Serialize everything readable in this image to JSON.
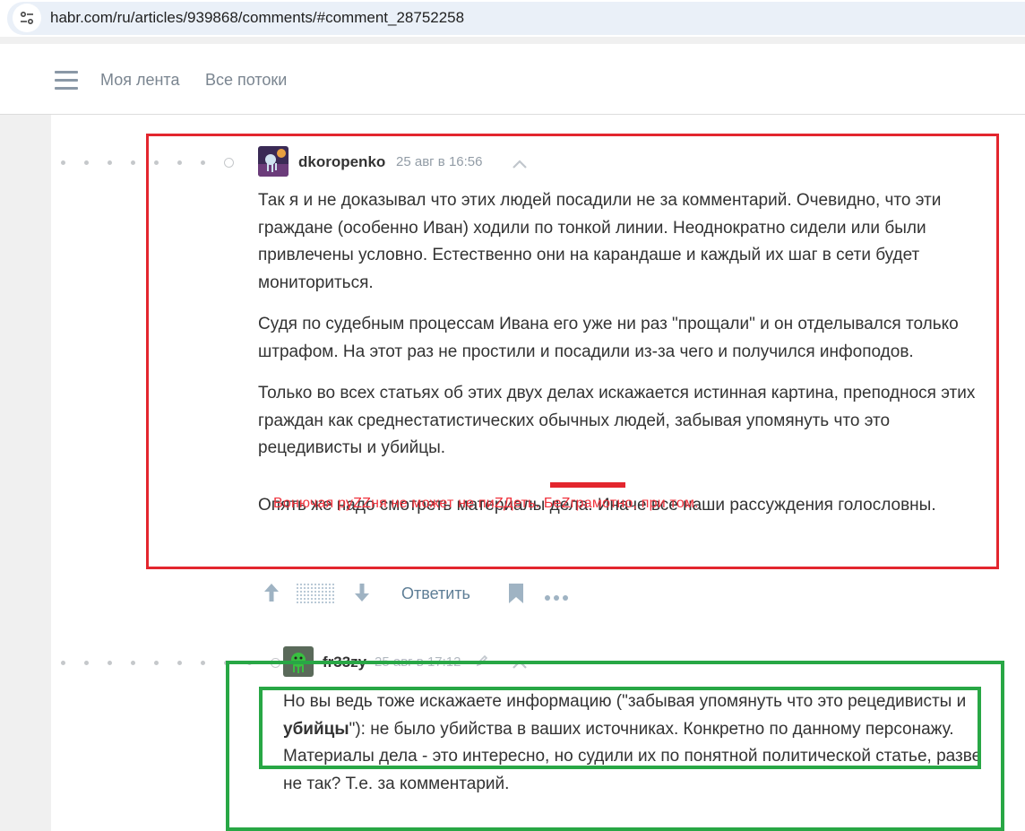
{
  "browser": {
    "url": "habr.com/ru/articles/939868/comments/#comment_28752258",
    "site_info_icon": "tune-icon"
  },
  "header": {
    "menu_icon": "hamburger-menu-icon",
    "nav": [
      "Моя лента",
      "Все потоки"
    ]
  },
  "comment1": {
    "author": "dkoropenko",
    "time": "25 авг в 16:56",
    "paragraphs": [
      "Так я и не доказывал что этих людей посадили не за комментарий. Очевидно, что эти граждане (особенно Иван) ходили по тонкой линии. Неоднократно сидели или были привлечены условно. Естественно они на карандаше и каждый их шаг в сети будет мониториться.",
      "Судя по судебным процессам Ивана его уже ни раз \"прощали\" и он отделывался только штрафом. На этот раз не простили и посадили из-за чего и получился инфоподов.",
      "Только во всех статьях об этих двух делах искажается истинная картина, преподнося этих граждан как среднестатистических обычных людей, забывая упомянуть что это рецедивисты и убийцы.",
      "Опять же надо смотреть материалы дела. Иначе все наши рассуждения голословны."
    ],
    "p3_main": "Только во всех статьях об этих двух делах искажается истинная картина, преподнося этих граждан как среднестатистических обычных людей, забывая упомянуть что это рецедивисты и ",
    "p3_tail": "убийцы."
  },
  "annotation": "Вонючая руZZня не может не пиZДеть. БеZграмотно, при том.",
  "actions": {
    "upvote_icon": "arrow-up-icon",
    "score_placeholder": "hidden-score",
    "downvote_icon": "arrow-down-icon",
    "reply": "Ответить",
    "bookmark_icon": "bookmark-icon",
    "more_icon": "more-dots-icon"
  },
  "comment2": {
    "author": "fr33zy",
    "time": "25 авг в 17:12",
    "p1_before": "Но вы ведь тоже искажаете информацию (\"забывая упомянуть что это рецедивисты и ",
    "p1_bold": "убийцы",
    "p1_after": "\"): не было убийства в ваших источниках. Конкретно по данному персонажу.",
    "p2": "Материалы дела - это интересно, но судили их по понятной политической статье, разве не так? Т.е. за комментарий."
  },
  "colors": {
    "highlight_red": "#e3262e",
    "highlight_green": "#28a745",
    "link": "#5e7e96"
  }
}
